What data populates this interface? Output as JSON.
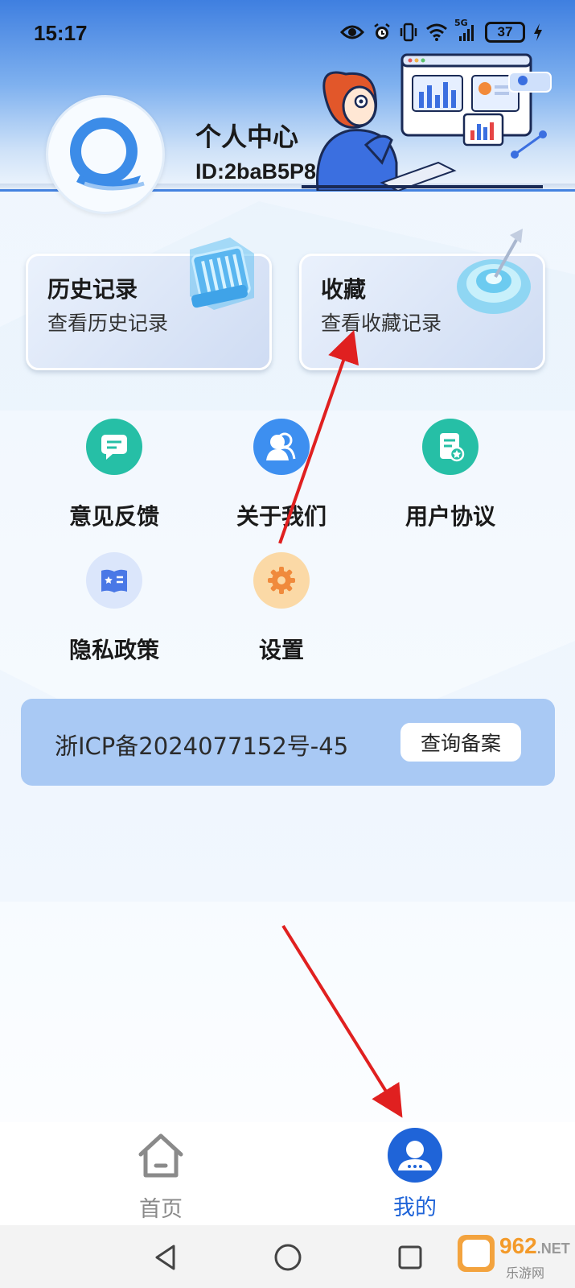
{
  "status_bar": {
    "time": "15:17",
    "network_label": "5G",
    "battery": "37",
    "icons": [
      "eye-icon",
      "alarm-icon",
      "vibrate-icon",
      "wifi-icon",
      "signal-icon",
      "battery-icon",
      "charging-icon"
    ]
  },
  "header": {
    "title": "个人中心",
    "user_id": "ID:2baB5P866"
  },
  "cards": [
    {
      "title": "历史记录",
      "subtitle": "查看历史记录",
      "icon": "folder-icon"
    },
    {
      "title": "收藏",
      "subtitle": "查看收藏记录",
      "icon": "target-icon"
    }
  ],
  "menu": [
    {
      "label": "意见反馈",
      "icon": "chat-icon",
      "color": "#26bfa6"
    },
    {
      "label": "关于我们",
      "icon": "users-icon",
      "color": "#3d8ff0"
    },
    {
      "label": "用户协议",
      "icon": "document-icon",
      "color": "#26bfa6"
    },
    {
      "label": "隐私政策",
      "icon": "book-icon",
      "color": "#4a78e6"
    },
    {
      "label": "设置",
      "icon": "gear-icon",
      "color": "#f29445"
    }
  ],
  "icp": {
    "text": "浙ICP备2024077152号-45",
    "button": "查询备案"
  },
  "bottom_nav": {
    "items": [
      {
        "label": "首页",
        "icon": "home-icon",
        "active": false
      },
      {
        "label": "我的",
        "icon": "user-icon",
        "active": true
      }
    ],
    "active_color": "#1f64d8",
    "inactive_color": "#8a8a8a"
  },
  "watermark": {
    "brand": "962",
    "suffix": ".NET",
    "subtitle": "乐游网"
  },
  "colors": {
    "annotation_arrow": "#e02020",
    "header_blue": "#3f7fe0"
  }
}
